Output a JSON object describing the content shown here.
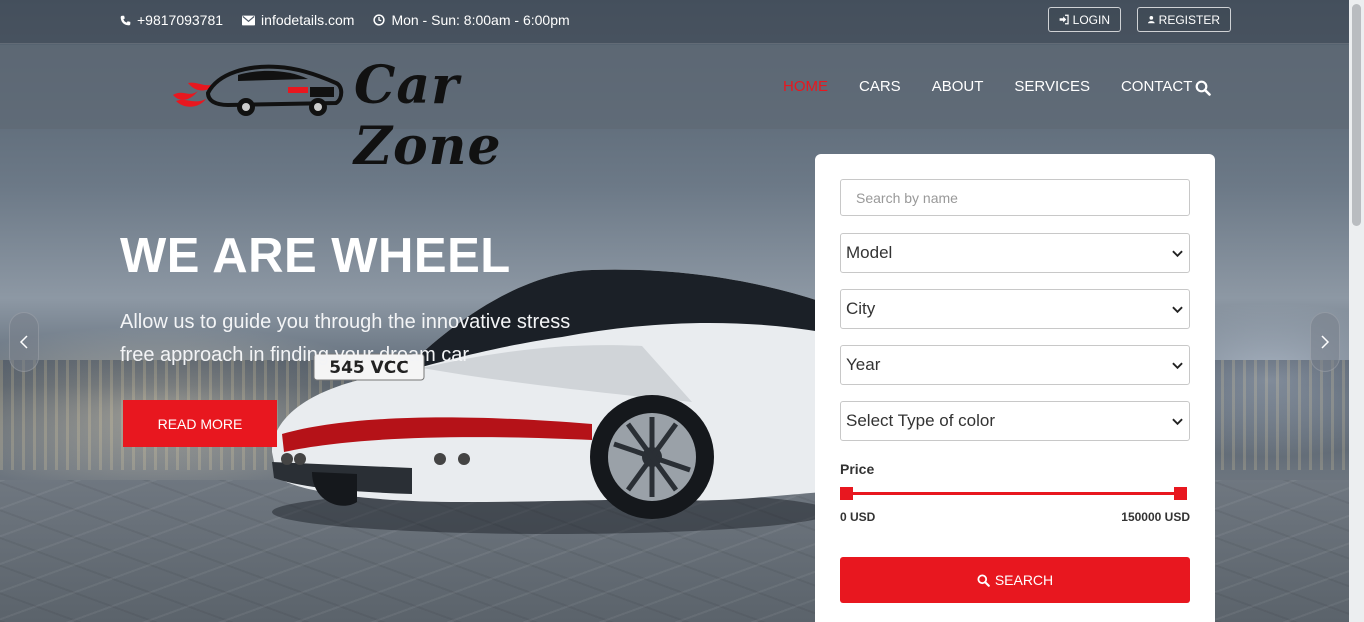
{
  "topbar": {
    "phone": "+9817093781",
    "email": "infodetails.com",
    "hours": "Mon - Sun: 8:00am - 6:00pm",
    "login": "LOGIN",
    "register": "REGISTER",
    "icons": {
      "phone": "phone-icon",
      "email": "envelope-icon",
      "hours": "clock-icon",
      "login": "sign-in-icon",
      "register": "user-icon"
    }
  },
  "logo": {
    "text": "Car Zone"
  },
  "nav": {
    "items": [
      {
        "label": "HOME",
        "active": true
      },
      {
        "label": "CARS",
        "active": false
      },
      {
        "label": "ABOUT",
        "active": false
      },
      {
        "label": "SERVICES",
        "active": false
      },
      {
        "label": "CONTACT",
        "active": false
      }
    ],
    "search_icon": "search-icon"
  },
  "hero": {
    "title": "WE ARE WHEEL",
    "subtitle": "Allow us to guide you through the innovative stress free approach in finding your dream car",
    "button": "READ MORE",
    "plate": "545 VCC"
  },
  "search_panel": {
    "search_placeholder": "Search by name",
    "model": "Model",
    "city": "City",
    "year": "Year",
    "color": "Select Type of color",
    "price_label": "Price",
    "price_min": "0 USD",
    "price_max": "150000 USD",
    "button": "SEARCH"
  },
  "colors": {
    "accent": "#e8171f"
  }
}
